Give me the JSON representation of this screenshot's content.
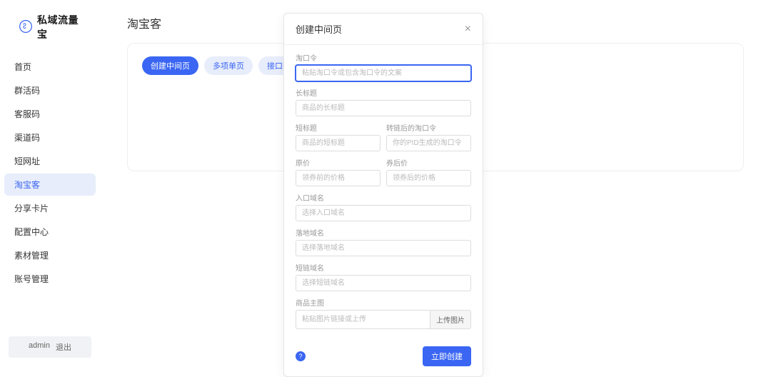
{
  "brand": "私域流量宝",
  "nav": {
    "items": [
      {
        "label": "首页"
      },
      {
        "label": "群活码"
      },
      {
        "label": "客服码"
      },
      {
        "label": "渠道码"
      },
      {
        "label": "短网址"
      },
      {
        "label": "淘宝客",
        "active": true
      },
      {
        "label": "分享卡片"
      },
      {
        "label": "配置中心"
      },
      {
        "label": "素材管理"
      },
      {
        "label": "账号管理"
      }
    ]
  },
  "bottom": {
    "user": "admin",
    "logout": "退出"
  },
  "page": {
    "title": "淘宝客",
    "tabs": [
      {
        "label": "创建中间页",
        "primary": true
      },
      {
        "label": "多项单页"
      },
      {
        "label": "接口配置"
      }
    ]
  },
  "modal": {
    "title": "创建中间页",
    "fields": {
      "taokouling": {
        "label": "淘口令",
        "placeholder": "粘贴淘口令或包含淘口令的文案"
      },
      "longTitle": {
        "label": "长标题",
        "placeholder": "商品的长标题"
      },
      "shortTitle": {
        "label": "短标题",
        "placeholder": "商品的短标题"
      },
      "convertedTkl": {
        "label": "转链后的淘口令",
        "placeholder": "你的PID生成的淘口令"
      },
      "origPrice": {
        "label": "原价",
        "placeholder": "领券前的价格"
      },
      "couponPrice": {
        "label": "券后价",
        "placeholder": "领券后的价格"
      },
      "entryDomain": {
        "label": "入口域名",
        "placeholder": "选择入口域名"
      },
      "landingDomain": {
        "label": "落地域名",
        "placeholder": "选择落地域名"
      },
      "shortDomain": {
        "label": "短链域名",
        "placeholder": "选择短链域名"
      },
      "mainImage": {
        "label": "商品主图",
        "placeholder": "粘贴图片链接或上传",
        "addon": "上传图片"
      }
    },
    "helpText": "?",
    "submit": "立即创建"
  }
}
